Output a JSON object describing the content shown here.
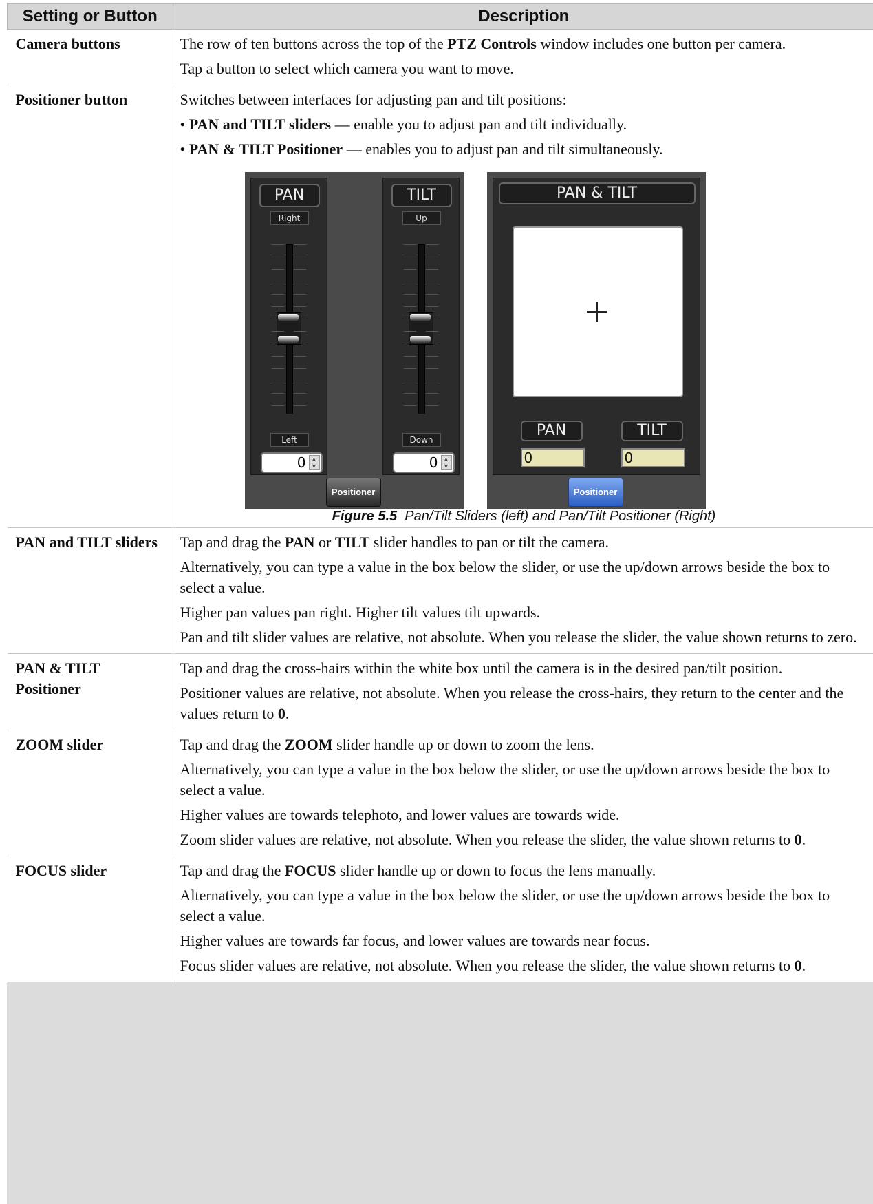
{
  "table": {
    "headers": [
      "Setting or Button",
      "Description"
    ]
  },
  "rows": {
    "camera": {
      "setting": "Camera buttons",
      "p1": [
        "The row of ten buttons across the top of the ",
        "PTZ Controls",
        " window includes one button per camera."
      ],
      "p2": "Tap a button to select which camera you want to move."
    },
    "positioner": {
      "setting": "Positioner button",
      "p1": "Switches between interfaces for adjusting pan and tilt positions:",
      "b1": [
        "• ",
        "PAN and TILT sliders",
        " — enable you to adjust pan and tilt individually."
      ],
      "b2": [
        "• ",
        "PAN & TILT Positioner",
        " — enables you to adjust pan and tilt simultaneously."
      ]
    },
    "pan_tilt_sliders": {
      "setting": "PAN and TILT sliders",
      "p1": [
        "Tap and drag the ",
        "PAN",
        " or ",
        "TILT",
        " slider handles to pan or tilt the camera."
      ],
      "p2": "Alternatively, you can type a value in the box below the slider, or use the up/down arrows beside the box to select a value.",
      "p3": "Higher pan values pan right. Higher tilt values tilt upwards.",
      "p4": "Pan and tilt slider values are relative, not absolute. When you release the slider, the value shown returns to zero."
    },
    "pan_tilt_positioner": {
      "setting": "PAN & TILT Positioner",
      "p1": "Tap and drag the cross-hairs within the white box until the camera is in the desired pan/tilt position.",
      "p2": [
        "Positioner values are relative, not absolute. When you release the cross-hairs, they return to the center and the values return to ",
        "0",
        "."
      ]
    },
    "zoom": {
      "setting": "ZOOM slider",
      "p1": [
        "Tap and drag the ",
        "ZOOM",
        " slider handle up or down to zoom the lens."
      ],
      "p2": "Alternatively, you can type a value in the box below the slider, or use the up/down arrows beside the box to select a value.",
      "p3": "Higher values are towards telephoto, and lower values are towards wide.",
      "p4": [
        "Zoom slider values are relative, not absolute. When you release the slider, the value shown returns to ",
        "0",
        "."
      ]
    },
    "focus": {
      "setting": "FOCUS slider",
      "p1": [
        "Tap and drag the ",
        "FOCUS",
        " slider handle up or down to focus the lens manually."
      ],
      "p2": "Alternatively, you can type a value in the box below the slider, or use the up/down arrows beside the box to select a value.",
      "p3": "Higher values are towards far focus, and lower values are towards near focus.",
      "p4": [
        "Focus slider values are relative, not absolute. When you release the slider, the value shown returns to ",
        "0",
        "."
      ]
    }
  },
  "figure": {
    "sliders": {
      "pan": {
        "label": "PAN",
        "top": "Right",
        "bottom": "Left",
        "value": "0"
      },
      "tilt": {
        "label": "TILT",
        "top": "Up",
        "bottom": "Down",
        "value": "0"
      },
      "positioner_button": "Positioner"
    },
    "positioner": {
      "title": "PAN & TILT",
      "pan_label": "PAN",
      "tilt_label": "TILT",
      "pan_value": "0",
      "tilt_value": "0",
      "positioner_button": "Positioner",
      "active_color": "#3a6fd4"
    },
    "caption_num": "Figure 5.5",
    "caption_text": "Pan/Tilt Sliders (left) and Pan/Tilt Positioner (Right)"
  }
}
